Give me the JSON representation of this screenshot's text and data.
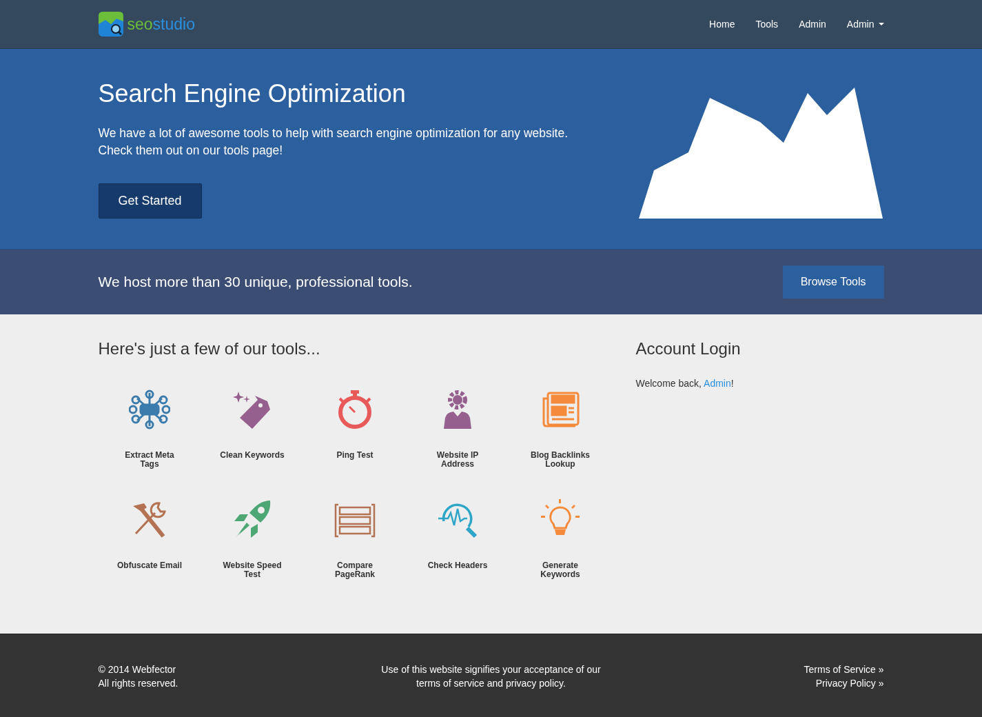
{
  "brand": {
    "part_1": "seo",
    "part_2": "studio"
  },
  "nav": [
    {
      "label": "Home",
      "kind": "link"
    },
    {
      "label": "Tools",
      "kind": "link"
    },
    {
      "label": "Admin",
      "kind": "link"
    },
    {
      "label": "Admin",
      "kind": "dropdown"
    }
  ],
  "hero": {
    "title": "Search Engine Optimization",
    "lines": [
      "We have a lot of awesome tools to help with search engine optimization for any website.",
      "Check them out on our tools page!"
    ],
    "button": "Get Started"
  },
  "band": {
    "text": "We host more than 30 unique, professional tools.",
    "button": "Browse Tools"
  },
  "tools": {
    "heading": "Here's just a few of our tools...",
    "items": [
      {
        "label": "Extract Meta Tags"
      },
      {
        "label": "Clean Keywords"
      },
      {
        "label": "Ping Test"
      },
      {
        "label": "Website IP Address"
      },
      {
        "label": "Blog Backlinks Lookup"
      },
      {
        "label": "Obfuscate Email"
      },
      {
        "label": "Website Speed Test"
      },
      {
        "label": "Compare PageRank"
      },
      {
        "label": "Check Headers"
      },
      {
        "label": "Generate Keywords"
      }
    ]
  },
  "login": {
    "heading": "Account Login",
    "welcome": "Welcome back, ",
    "user": "Admin",
    "end": "!"
  },
  "footer": {
    "left": [
      "© 2014 Webfector",
      "All rights reserved."
    ],
    "center": [
      "Use of this website signifies your acceptance of our",
      "terms of service and privacy policy."
    ],
    "links": [
      "Terms of Service »",
      "Privacy Policy »"
    ]
  }
}
